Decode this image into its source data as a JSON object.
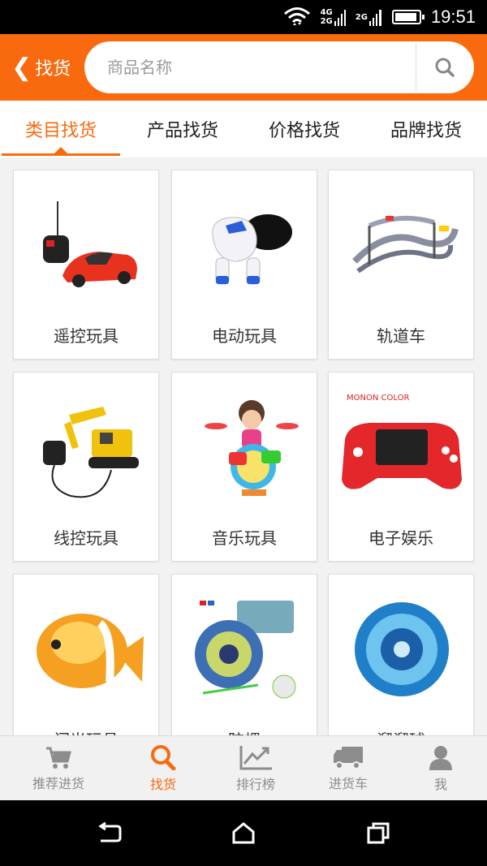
{
  "status_bar": {
    "time": "19:51",
    "network_top": "4G",
    "network_bottom": "2G",
    "network_second": "2G"
  },
  "header": {
    "back_label": "找货",
    "search_placeholder": "商品名称"
  },
  "tabs": [
    {
      "label": "类目找货",
      "active": true
    },
    {
      "label": "产品找货",
      "active": false
    },
    {
      "label": "价格找货",
      "active": false
    },
    {
      "label": "品牌找货",
      "active": false
    }
  ],
  "categories": [
    {
      "label": "遥控玩具",
      "icon": "rc-car-icon"
    },
    {
      "label": "电动玩具",
      "icon": "robot-dog-icon"
    },
    {
      "label": "轨道车",
      "icon": "race-track-icon"
    },
    {
      "label": "线控玩具",
      "icon": "excavator-icon"
    },
    {
      "label": "音乐玩具",
      "icon": "drum-set-icon"
    },
    {
      "label": "电子娱乐",
      "icon": "game-console-icon"
    },
    {
      "label": "闪光玩具",
      "icon": "clownfish-icon"
    },
    {
      "label": "陀螺",
      "icon": "spinning-top-icon"
    },
    {
      "label": "溜溜球",
      "icon": "yoyo-icon"
    }
  ],
  "console_brand": "MONON COLOR",
  "bottom_nav": [
    {
      "label": "推荐进货",
      "icon": "cart-icon",
      "active": false
    },
    {
      "label": "找货",
      "icon": "search-icon",
      "active": true
    },
    {
      "label": "排行榜",
      "icon": "chart-icon",
      "active": false
    },
    {
      "label": "进货车",
      "icon": "truck-icon",
      "active": false
    },
    {
      "label": "我",
      "icon": "user-icon",
      "active": false
    }
  ],
  "colors": {
    "brand": "#f96a0e",
    "inactive": "#8c8c8c"
  }
}
